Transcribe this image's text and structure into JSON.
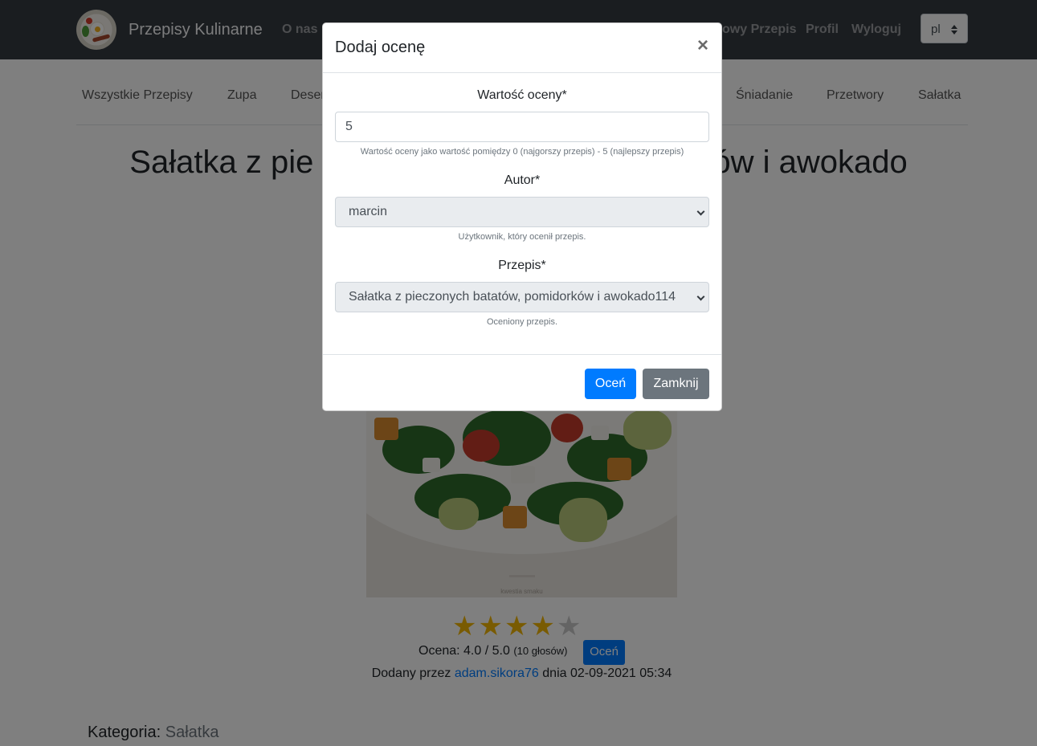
{
  "navbar": {
    "brand": "Przepisy Kulinarne",
    "links": [
      "O nas",
      "owy Przepis",
      "Profil",
      "Wyloguj"
    ],
    "language": "pl"
  },
  "categories": [
    "Wszystkie Przepisy",
    "Zupa",
    "Deser",
    "Śniadanie",
    "Przetwory",
    "Sałatka"
  ],
  "recipe": {
    "title_left": "Sałatka z pie",
    "title_right": "ów i awokado",
    "image_caption": "kwestia smaku",
    "rating_stars": 4,
    "rating_max": 5,
    "rating_label": "Ocena: 4.0 / 5.0",
    "votes": "(10 głosów)",
    "rate_button": "Oceń",
    "added_by_prefix": "Dodany przez",
    "author": "adam.sikora76",
    "added_by_suffix": "dnia 02-09-2021 05:34",
    "category_label": "Kategoria:",
    "category_value": "Sałatka"
  },
  "modal": {
    "title": "Dodaj ocenę",
    "close": "×",
    "value_label": "Wartość oceny*",
    "value": "5",
    "value_help": "Wartość oceny jako wartość pomiędzy 0 (najgorszy przepis) - 5 (najlepszy przepis)",
    "author_label": "Autor*",
    "author_value": "marcin",
    "author_help": "Użytkownik, który ocenił przepis.",
    "recipe_label": "Przepis*",
    "recipe_value": "Sałatka z pieczonych batatów, pomidorków i awokado114",
    "recipe_help": "Oceniony przepis.",
    "submit": "Oceń",
    "dismiss": "Zamknij"
  }
}
